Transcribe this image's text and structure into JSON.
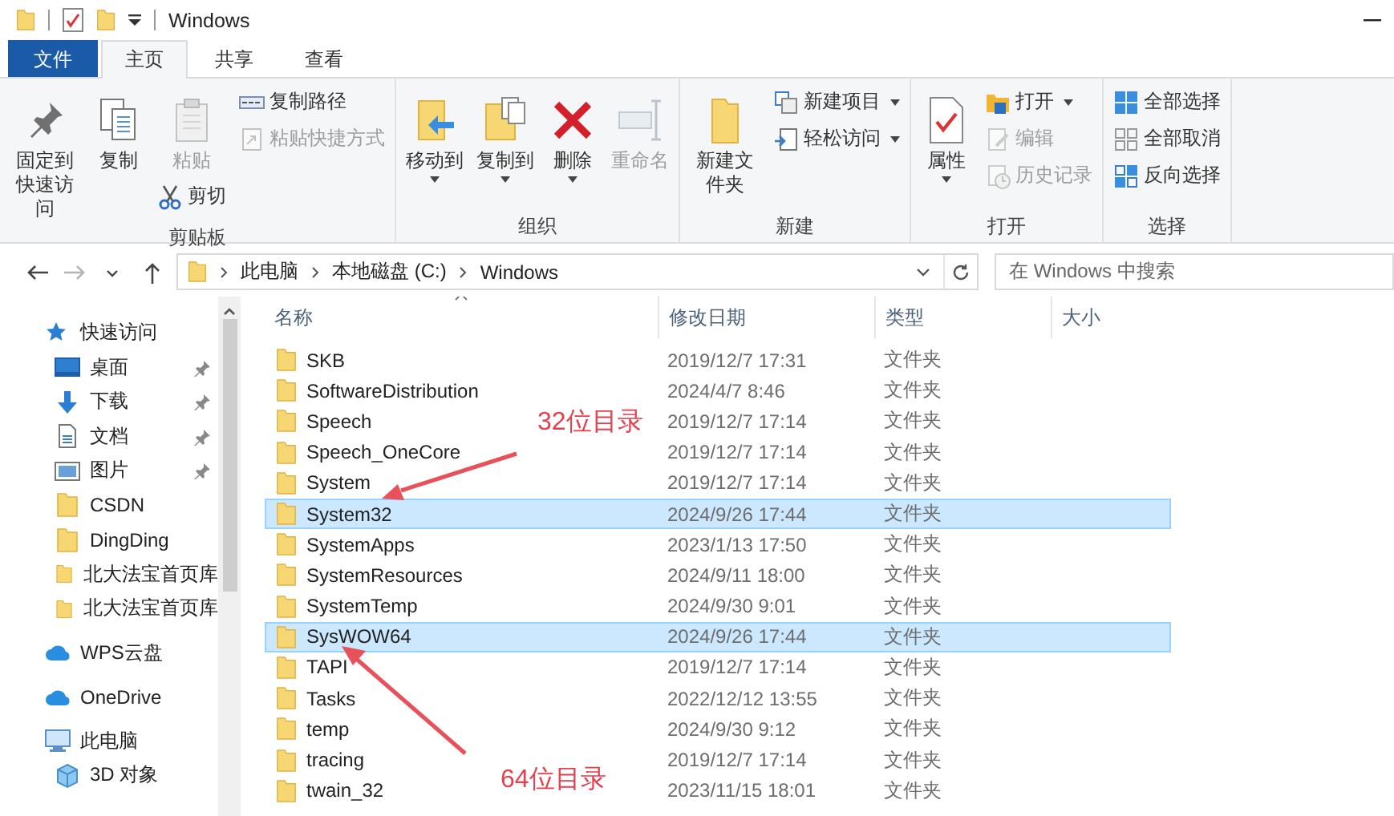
{
  "window": {
    "title": "Windows"
  },
  "tabs": [
    {
      "label": "文件",
      "kind": "file",
      "selected": false
    },
    {
      "label": "主页",
      "kind": "tab",
      "selected": true
    },
    {
      "label": "共享",
      "kind": "tab",
      "selected": false
    },
    {
      "label": "查看",
      "kind": "tab",
      "selected": false
    }
  ],
  "ribbon": {
    "groups": [
      {
        "label": "剪贴板",
        "columns": [
          {
            "items": [
              {
                "kind": "large",
                "label": "固定到快速访问",
                "disabled": false,
                "dropdown": false
              }
            ]
          },
          {
            "items": [
              {
                "kind": "large",
                "label": "复制",
                "disabled": false,
                "dropdown": false
              }
            ]
          },
          {
            "items": [
              {
                "kind": "large",
                "label": "粘贴",
                "disabled": true,
                "dropdown": false
              },
              {
                "kind": "small",
                "label": "剪切",
                "disabled": false,
                "dropdown": false
              }
            ]
          },
          {
            "items": [
              {
                "kind": "small",
                "label": "复制路径",
                "disabled": false,
                "dropdown": false
              },
              {
                "kind": "small",
                "label": "粘贴快捷方式",
                "disabled": true,
                "dropdown": false
              }
            ]
          }
        ]
      },
      {
        "label": "组织",
        "columns": [
          {
            "items": [
              {
                "kind": "large",
                "label": "移动到",
                "disabled": false,
                "dropdown": true
              }
            ]
          },
          {
            "items": [
              {
                "kind": "large",
                "label": "复制到",
                "disabled": false,
                "dropdown": true
              }
            ]
          },
          {
            "items": [
              {
                "kind": "large",
                "label": "删除",
                "disabled": false,
                "dropdown": true
              }
            ]
          },
          {
            "items": [
              {
                "kind": "large",
                "label": "重命名",
                "disabled": true,
                "dropdown": false
              }
            ]
          }
        ]
      },
      {
        "label": "新建",
        "columns": [
          {
            "items": [
              {
                "kind": "large",
                "label": "新建文件夹",
                "disabled": false,
                "dropdown": false
              }
            ]
          },
          {
            "items": [
              {
                "kind": "small",
                "label": "新建项目",
                "disabled": false,
                "dropdown": true
              },
              {
                "kind": "small",
                "label": "轻松访问",
                "disabled": false,
                "dropdown": true
              }
            ]
          }
        ]
      },
      {
        "label": "打开",
        "columns": [
          {
            "items": [
              {
                "kind": "large",
                "label": "属性",
                "disabled": false,
                "dropdown": true
              }
            ]
          },
          {
            "items": [
              {
                "kind": "small",
                "label": "打开",
                "disabled": false,
                "dropdown": true
              },
              {
                "kind": "small",
                "label": "编辑",
                "disabled": true,
                "dropdown": false
              },
              {
                "kind": "small",
                "label": "历史记录",
                "disabled": true,
                "dropdown": false
              }
            ]
          }
        ]
      },
      {
        "label": "选择",
        "columns": [
          {
            "items": [
              {
                "kind": "small",
                "label": "全部选择",
                "disabled": false,
                "dropdown": false
              },
              {
                "kind": "small",
                "label": "全部取消",
                "disabled": false,
                "dropdown": false
              },
              {
                "kind": "small",
                "label": "反向选择",
                "disabled": false,
                "dropdown": false
              }
            ]
          }
        ]
      }
    ]
  },
  "nav_buttons": [
    {
      "kind": "back",
      "disabled": false
    },
    {
      "kind": "forward",
      "disabled": true
    },
    {
      "kind": "recent",
      "disabled": false
    },
    {
      "kind": "up",
      "disabled": false
    }
  ],
  "address": {
    "path": [
      "此电脑",
      "本地磁盘 (C:)",
      "Windows"
    ]
  },
  "search": {
    "placeholder": "在 Windows 中搜索"
  },
  "nav_pane": {
    "sections": [
      {
        "label": "快速访问",
        "kind": "star",
        "children": [
          {
            "label": "桌面",
            "kind": "desktop",
            "pinned": true
          },
          {
            "label": "下载",
            "kind": "download",
            "pinned": true
          },
          {
            "label": "文档",
            "kind": "document",
            "pinned": true
          },
          {
            "label": "图片",
            "kind": "picture",
            "pinned": true
          },
          {
            "label": "CSDN",
            "kind": "folder",
            "pinned": false
          },
          {
            "label": "DingDing",
            "kind": "folder",
            "pinned": false
          },
          {
            "label": "北大法宝首页库",
            "kind": "folder",
            "pinned": false
          },
          {
            "label": "北大法宝首页库",
            "kind": "folder",
            "pinned": false
          }
        ]
      },
      {
        "label": "WPS云盘",
        "kind": "cloud"
      },
      {
        "label": "OneDrive",
        "kind": "cloud"
      },
      {
        "label": "此电脑",
        "kind": "pc",
        "children": [
          {
            "label": "3D 对象",
            "kind": "cube",
            "pinned": false
          }
        ]
      }
    ]
  },
  "file_list": {
    "columns": [
      "名称",
      "修改日期",
      "类型",
      "大小"
    ],
    "rows": [
      {
        "name": "SKB",
        "date": "2019/12/7 17:31",
        "type": "文件夹",
        "selected": false
      },
      {
        "name": "SoftwareDistribution",
        "date": "2024/4/7 8:46",
        "type": "文件夹",
        "selected": false
      },
      {
        "name": "Speech",
        "date": "2019/12/7 17:14",
        "type": "文件夹",
        "selected": false
      },
      {
        "name": "Speech_OneCore",
        "date": "2019/12/7 17:14",
        "type": "文件夹",
        "selected": false
      },
      {
        "name": "System",
        "date": "2019/12/7 17:14",
        "type": "文件夹",
        "selected": false
      },
      {
        "name": "System32",
        "date": "2024/9/26 17:44",
        "type": "文件夹",
        "selected": true
      },
      {
        "name": "SystemApps",
        "date": "2023/1/13 17:50",
        "type": "文件夹",
        "selected": false
      },
      {
        "name": "SystemResources",
        "date": "2024/9/11 18:00",
        "type": "文件夹",
        "selected": false
      },
      {
        "name": "SystemTemp",
        "date": "2024/9/30 9:01",
        "type": "文件夹",
        "selected": false
      },
      {
        "name": "SysWOW64",
        "date": "2024/9/26 17:44",
        "type": "文件夹",
        "selected": true
      },
      {
        "name": "TAPI",
        "date": "2019/12/7 17:14",
        "type": "文件夹",
        "selected": false
      },
      {
        "name": "Tasks",
        "date": "2022/12/12 13:55",
        "type": "文件夹",
        "selected": false
      },
      {
        "name": "temp",
        "date": "2024/9/30 9:12",
        "type": "文件夹",
        "selected": false
      },
      {
        "name": "tracing",
        "date": "2019/12/7 17:14",
        "type": "文件夹",
        "selected": false
      },
      {
        "name": "twain_32",
        "date": "2023/11/15 18:01",
        "type": "文件夹",
        "selected": false
      }
    ]
  },
  "annotations": [
    {
      "text": "32位目录"
    },
    {
      "text": "64位目录"
    }
  ]
}
